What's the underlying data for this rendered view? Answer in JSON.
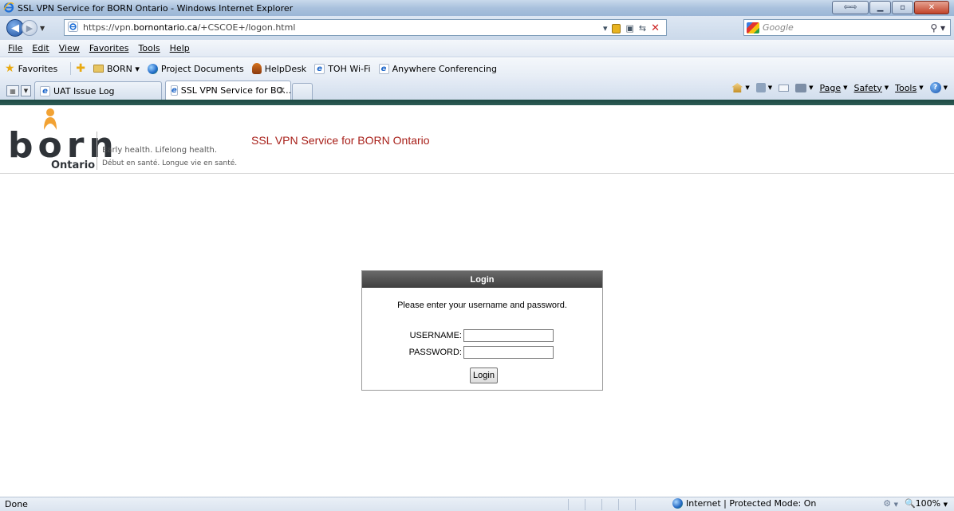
{
  "window": {
    "title": "SSL VPN Service for BORN Ontario - Windows Internet Explorer",
    "controls": [
      "restore-down",
      "minimize",
      "maximize",
      "close"
    ]
  },
  "address_bar": {
    "url_prefix": "https://vpn.",
    "url_domain": "bornontario.ca",
    "url_path": "/+CSCOE+/logon.html",
    "search_placeholder": "Google"
  },
  "menu": {
    "items": [
      "File",
      "Edit",
      "View",
      "Favorites",
      "Tools",
      "Help"
    ]
  },
  "favorites_bar": {
    "favorites_label": "Favorites",
    "items": [
      {
        "label": "BORN ▾",
        "icon": "folder-icon"
      },
      {
        "label": "Project Documents",
        "icon": "globe-icon"
      },
      {
        "label": "HelpDesk",
        "icon": "helpdesk-icon"
      },
      {
        "label": "TOH Wi-Fi",
        "icon": "ie-page-icon"
      },
      {
        "label": "Anywhere Conferencing",
        "icon": "ie-page-icon"
      }
    ]
  },
  "tabs": [
    {
      "label": "UAT Issue Log",
      "active": false
    },
    {
      "label": "SSL VPN Service for BO...",
      "active": true
    }
  ],
  "command_bar": {
    "page": "Page",
    "safety": "Safety",
    "tools": "Tools"
  },
  "page": {
    "logo_word": "born",
    "logo_region": "Ontario",
    "tagline_en": "Early health. Lifelong health.",
    "tagline_fr": "Début en santé. Longue vie en santé.",
    "site_title": "SSL VPN Service for BORN Ontario",
    "accent_color": "#a8201a"
  },
  "login": {
    "heading": "Login",
    "message": "Please enter your username and password.",
    "username_label": "USERNAME:",
    "username_value": "",
    "password_label": "PASSWORD:",
    "password_value": "",
    "submit_label": "Login"
  },
  "status_bar": {
    "status": "Done",
    "zone": "Internet | Protected Mode: On",
    "zoom": "100%"
  }
}
